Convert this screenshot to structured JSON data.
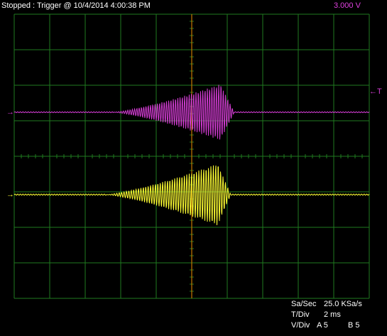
{
  "status_text": "Stopped : Trigger @ 10/4/2014 4:00:38 PM",
  "trigger_level": "3.000  V",
  "readouts": {
    "sa_sec_label": "Sa/Sec",
    "sa_sec_value": "25.0 KSa/s",
    "t_div_label": "T/Div",
    "t_div_value": "2 ms",
    "v_div_label": "V/Div",
    "v_div_a": "A 5",
    "v_div_b": "B 5"
  },
  "markers": {
    "trigger_marker": "←T",
    "channel_a_marker": "→",
    "channel_b_marker": "→"
  },
  "colors": {
    "background": "#000000",
    "grid": "#1f7a1f",
    "channel_a": "#d23cd2",
    "channel_b": "#ffff33",
    "trigger_cursor": "#c87800",
    "text": "#ffffff"
  }
}
